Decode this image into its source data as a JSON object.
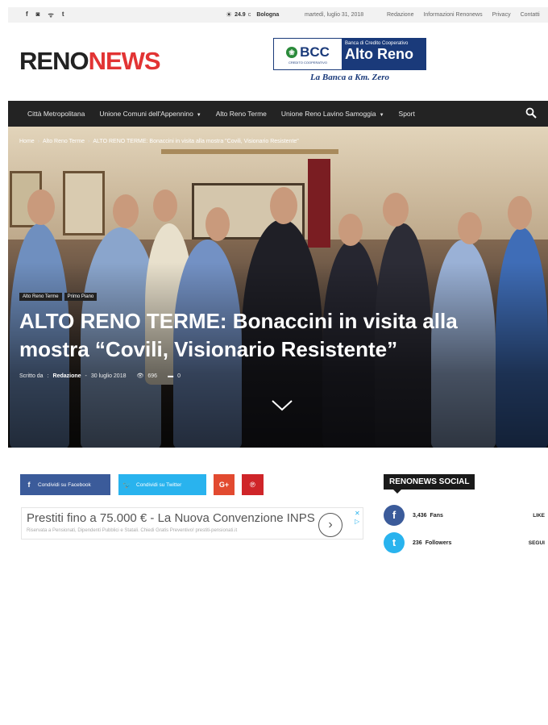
{
  "topbar": {
    "social_icons": [
      "f",
      "◙",
      "ᯤ",
      "t"
    ],
    "temp": "24.9",
    "unit": "C",
    "city": "Bologna",
    "date": "martedì, luglio 31, 2018",
    "links": [
      "Redazione",
      "Informazioni Renonews",
      "Privacy",
      "Contatti"
    ]
  },
  "header": {
    "logo_part1": "RENO",
    "logo_part2": "NEWS",
    "bank_bcc": "BCC",
    "bank_sub": "CREDITO COOPERATIVO",
    "bank_tagline_small": "Banca di Credito Cooperativo",
    "bank_name": "Alto Reno",
    "bank_slogan": "La Banca a Km. Zero"
  },
  "nav": {
    "items": [
      {
        "label": "Città Metropolitana",
        "caret": ""
      },
      {
        "label": "Unione Comuni dell'Appennino",
        "caret": "▼"
      },
      {
        "label": "Alto Reno Terme",
        "caret": ""
      },
      {
        "label": "Unione Reno Lavino Samoggia",
        "caret": "▼"
      },
      {
        "label": "Sport",
        "caret": ""
      }
    ]
  },
  "article": {
    "breadcrumb": [
      "Home",
      "Alto Reno Terme",
      "ALTO RENO TERME: Bonaccini in visita alla mostra \"Covili, Visionario Resistente\""
    ],
    "tags": [
      "Alto Reno Terme",
      "Primo Piano"
    ],
    "title": "ALTO RENO TERME: Bonaccini in visita alla mostra “Covili, Visionario Resistente”",
    "by_label": "Scritto da",
    "author": "Redazione",
    "date": "30 luglio 2018",
    "views": "696",
    "comments": "0"
  },
  "share": {
    "facebook": "Condividi su Facebook",
    "twitter": "Condividi su Twitter",
    "gplus": "G+",
    "pinterest": "℗"
  },
  "ad": {
    "title": "Prestiti fino a 75.000 € - La Nuova Convenzione INPS",
    "subtitle": "Riservata a Pensionati, Dipendenti Pubblici e Statali. Chiedi Gratis Preventivo! prestiti-pensionati.it",
    "cta": "›",
    "adchoices": "✕\n▷"
  },
  "social_widget": {
    "title": "RENONEWS SOCIAL",
    "facebook": {
      "icon": "f",
      "count": "3,436",
      "label": "Fans",
      "action": "LIKE"
    },
    "twitter": {
      "icon": "t",
      "count": "236",
      "label": "Followers",
      "action": "SEGUI"
    }
  },
  "colors": {
    "brand_red": "#e23434",
    "nav_bg": "#232323",
    "facebook": "#3b5b9a",
    "twitter": "#29b3ee",
    "gplus": "#e24a30",
    "pinterest": "#cf2529",
    "bank_blue": "#1a3a7a"
  }
}
